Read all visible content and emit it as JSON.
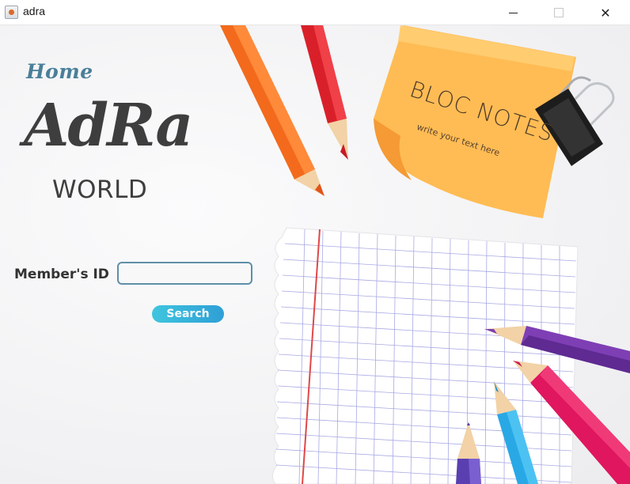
{
  "window": {
    "title": "adra",
    "minimize_symbol": "",
    "close_symbol": "✕"
  },
  "home": {
    "label": "Home"
  },
  "logo": {
    "main": "AdRa",
    "sub": "WORLD"
  },
  "form": {
    "member_id_label": "Member's ID",
    "member_id_value": "",
    "search_label": "Search"
  },
  "notepad": {
    "title": "BLOC NOTES",
    "subtitle": "write your text here"
  },
  "colors": {
    "accent": "#4a7f98",
    "button": "#2f9fd6",
    "sticky_note": "#ffbb55",
    "grid_lines": "#8d8fd6",
    "margin_line": "#e04848"
  }
}
